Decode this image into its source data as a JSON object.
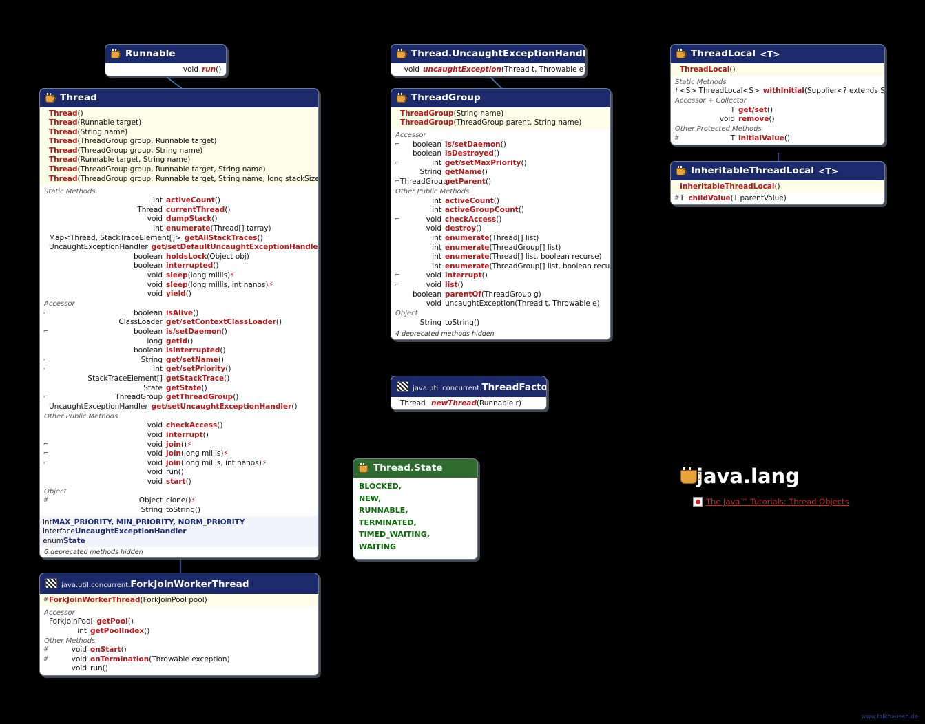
{
  "package": {
    "title": "java.lang",
    "tutorial_label": "The Java™ Tutorials: Thread Objects"
  },
  "credit": "www.falkhausen.de",
  "boxes": {
    "runnable": {
      "title": "Runnable",
      "rows": [
        {
          "mk": "",
          "rt": "void",
          "nm": "run",
          "italic": true,
          "args": " ()"
        }
      ]
    },
    "thread": {
      "title": "Thread",
      "ctors": [
        {
          "nm": "Thread",
          "args": " ()"
        },
        {
          "nm": "Thread",
          "args": " (Runnable target)"
        },
        {
          "nm": "Thread",
          "args": " (String name)"
        },
        {
          "nm": "Thread",
          "args": " (ThreadGroup group, Runnable target)"
        },
        {
          "nm": "Thread",
          "args": " (ThreadGroup group, String name)"
        },
        {
          "nm": "Thread",
          "args": " (Runnable target, String name)"
        },
        {
          "nm": "Thread",
          "args": " (ThreadGroup group, Runnable target, String name)"
        },
        {
          "nm": "Thread",
          "args": " (ThreadGroup group, Runnable target, String name, long stackSize)"
        }
      ],
      "groups": [
        {
          "label": "Static Methods",
          "rows": [
            {
              "mk": "",
              "rt": "int",
              "nm": "activeCount",
              "args": " ()"
            },
            {
              "mk": "",
              "rt": "Thread",
              "nm": "currentThread",
              "args": " ()"
            },
            {
              "mk": "",
              "rt": "void",
              "nm": "dumpStack",
              "args": " ()"
            },
            {
              "mk": "",
              "rt": "int",
              "nm": "enumerate",
              "args": " (Thread[] tarray)"
            },
            {
              "mk": "",
              "rt": "Map<Thread, StackTraceElement[]>",
              "nm": "getAllStackTraces",
              "args": " ()",
              "wide": true
            },
            {
              "mk": "",
              "rt": "UncaughtExceptionHandler",
              "nm": "get/setDefaultUncaughtExceptionHandler",
              "args": " ()",
              "wide": true
            },
            {
              "mk": "",
              "rt": "boolean",
              "nm": "holdsLock",
              "args": " (Object obj)"
            },
            {
              "mk": "",
              "rt": "boolean",
              "nm": "interrupted",
              "args": " ()"
            },
            {
              "mk": "",
              "rt": "void",
              "nm": "sleep",
              "args": " (long millis)",
              "pct": true
            },
            {
              "mk": "",
              "rt": "void",
              "nm": "sleep",
              "args": " (long millis, int nanos)",
              "pct": true
            },
            {
              "mk": "",
              "rt": "void",
              "nm": "yield",
              "args": " ()"
            }
          ]
        },
        {
          "label": "Accessor",
          "rows": [
            {
              "mk": "⌐",
              "rt": "boolean",
              "nm": "isAlive",
              "args": " ()"
            },
            {
              "mk": "",
              "rt": "ClassLoader",
              "nm": "get/setContextClassLoader",
              "args": " ()"
            },
            {
              "mk": "⌐",
              "rt": "boolean",
              "nm": "is/setDaemon",
              "args": " ()"
            },
            {
              "mk": "",
              "rt": "long",
              "nm": "getId",
              "args": " ()"
            },
            {
              "mk": "",
              "rt": "boolean",
              "nm": "isInterrupted",
              "args": " ()"
            },
            {
              "mk": "⌐",
              "rt": "String",
              "nm": "get/setName",
              "args": " ()"
            },
            {
              "mk": "⌐",
              "rt": "int",
              "nm": "get/setPriority",
              "args": " ()"
            },
            {
              "mk": "",
              "rt": "StackTraceElement[]",
              "nm": "getStackTrace",
              "args": " ()"
            },
            {
              "mk": "",
              "rt": "State",
              "nm": "getState",
              "args": " ()"
            },
            {
              "mk": "⌐",
              "rt": "ThreadGroup",
              "nm": "getThreadGroup",
              "args": " ()"
            },
            {
              "mk": "",
              "rt": "UncaughtExceptionHandler",
              "nm": "get/setUncaughtExceptionHandler",
              "args": " ()",
              "wide": true
            }
          ]
        },
        {
          "label": "Other Public Methods",
          "rows": [
            {
              "mk": "",
              "rt": "void",
              "nm": "checkAccess",
              "args": " ()"
            },
            {
              "mk": "",
              "rt": "void",
              "nm": "interrupt",
              "args": " ()"
            },
            {
              "mk": "⌐",
              "rt": "void",
              "nm": "join",
              "args": " ()",
              "pct": true
            },
            {
              "mk": "⌐",
              "rt": "void",
              "nm": "join",
              "args": " (long millis)",
              "pct": true
            },
            {
              "mk": "⌐",
              "rt": "void",
              "nm": "join",
              "args": " (long millis, int nanos)",
              "pct": true
            },
            {
              "mk": "",
              "rt": "void",
              "nm": "run",
              "args": " ()",
              "plain": true
            },
            {
              "mk": "",
              "rt": "void",
              "nm": "start",
              "args": " ()"
            }
          ]
        },
        {
          "label": "Object",
          "rows": [
            {
              "mk": "#",
              "rt": "Object",
              "nm": "clone",
              "args": " ()",
              "plain": true,
              "pct": true
            },
            {
              "mk": "",
              "rt": "String",
              "nm": "toString",
              "args": " ()",
              "plain": true
            }
          ]
        }
      ],
      "fields": [
        {
          "pre": "int",
          "nm": "MAX_PRIORITY, MIN_PRIORITY, NORM_PRIORITY"
        },
        {
          "pre": "interface",
          "nm": "UncaughtExceptionHandler"
        },
        {
          "pre": "enum",
          "nm": "State"
        }
      ],
      "deprecated": "6 deprecated methods hidden"
    },
    "forkjoin": {
      "pkg": "java.util.concurrent.",
      "title": "ForkJoinWorkerThread",
      "ctors": [
        {
          "mk": "#",
          "nm": "ForkJoinWorkerThread",
          "args": " (ForkJoinPool pool)"
        }
      ],
      "groups": [
        {
          "label": "Accessor",
          "rows": [
            {
              "mk": "",
              "rt": "ForkJoinPool",
              "nm": "getPool",
              "args": " ()",
              "leftType": true
            },
            {
              "mk": "",
              "rt": "int",
              "nm": "getPoolIndex",
              "args": " ()"
            }
          ]
        },
        {
          "label": "Other Methods",
          "rows": [
            {
              "mk": "#",
              "rt": "void",
              "nm": "onStart",
              "args": " ()"
            },
            {
              "mk": "#",
              "rt": "void",
              "nm": "onTermination",
              "args": " (Throwable exception)"
            },
            {
              "mk": "",
              "rt": "void",
              "nm": "run",
              "args": " ()",
              "plain": true
            }
          ]
        }
      ]
    },
    "ueh": {
      "title": "Thread.UncaughtExceptionHandler",
      "rows": [
        {
          "mk": "",
          "rt": "void",
          "nm": "uncaughtException",
          "italic": true,
          "args": " (Thread t, Throwable e)"
        }
      ]
    },
    "threadgroup": {
      "title": "ThreadGroup",
      "ctors": [
        {
          "nm": "ThreadGroup",
          "args": " (String name)"
        },
        {
          "nm": "ThreadGroup",
          "args": " (ThreadGroup parent, String name)"
        }
      ],
      "groups": [
        {
          "label": "Accessor",
          "rows": [
            {
              "mk": "⌐",
              "rt": "boolean",
              "nm": "is/setDaemon",
              "args": " ()"
            },
            {
              "mk": "",
              "rt": "boolean",
              "nm": "isDestroyed",
              "args": " ()"
            },
            {
              "mk": "⌐",
              "rt": "int",
              "nm": "get/setMaxPriority",
              "args": " ()"
            },
            {
              "mk": "",
              "rt": "String",
              "nm": "getName",
              "args": " ()"
            },
            {
              "mk": "⌐",
              "rt": "ThreadGroup",
              "nm": "getParent",
              "args": " ()"
            }
          ]
        },
        {
          "label": "Other Public Methods",
          "rows": [
            {
              "mk": "",
              "rt": "int",
              "nm": "activeCount",
              "args": " ()"
            },
            {
              "mk": "",
              "rt": "int",
              "nm": "activeGroupCount",
              "args": " ()"
            },
            {
              "mk": "⌐",
              "rt": "void",
              "nm": "checkAccess",
              "args": " ()"
            },
            {
              "mk": "",
              "rt": "void",
              "nm": "destroy",
              "args": " ()"
            },
            {
              "mk": "",
              "rt": "int",
              "nm": "enumerate",
              "args": " (Thread[] list)"
            },
            {
              "mk": "",
              "rt": "int",
              "nm": "enumerate",
              "args": " (ThreadGroup[] list)"
            },
            {
              "mk": "",
              "rt": "int",
              "nm": "enumerate",
              "args": " (Thread[] list, boolean recurse)"
            },
            {
              "mk": "",
              "rt": "int",
              "nm": "enumerate",
              "args": " (ThreadGroup[] list, boolean recurse)"
            },
            {
              "mk": "⌐",
              "rt": "void",
              "nm": "interrupt",
              "args": " ()"
            },
            {
              "mk": "⌐",
              "rt": "void",
              "nm": "list",
              "args": " ()"
            },
            {
              "mk": "",
              "rt": "boolean",
              "nm": "parentOf",
              "args": " (ThreadGroup g)"
            },
            {
              "mk": "",
              "rt": "void",
              "nm": "uncaughtException",
              "args": " (Thread t, Throwable e)",
              "plain": true
            }
          ]
        },
        {
          "label": "Object",
          "rows": [
            {
              "mk": "",
              "rt": "String",
              "nm": "toString",
              "args": " ()",
              "plain": true
            }
          ]
        }
      ],
      "deprecated": "4 deprecated methods hidden"
    },
    "threadfactory": {
      "pkg": "java.util.concurrent.",
      "title": "ThreadFactory",
      "rows": [
        {
          "mk": "",
          "rt": "Thread",
          "nm": "newThread",
          "italic": true,
          "args": " (Runnable r)",
          "leftType": true
        }
      ]
    },
    "threadlocal": {
      "title": "ThreadLocal",
      "generic": "<T>",
      "ctors": [
        {
          "nm": "ThreadLocal",
          "args": " ()"
        }
      ],
      "groups": [
        {
          "label": "Static Methods",
          "rows": [
            {
              "mk": "!",
              "rt": "<S> ThreadLocal<S>",
              "nm": "withInitial",
              "args": " (Supplier<? extends S> supplier)",
              "wide": true,
              "leftType": true
            }
          ]
        },
        {
          "label": "Accessor + Collector",
          "rows": [
            {
              "mk": "",
              "rt": "T",
              "nm": "get/set",
              "args": " ()"
            },
            {
              "mk": "",
              "rt": "void",
              "nm": "remove",
              "args": " ()"
            }
          ]
        },
        {
          "label": "Other Protected Methods",
          "rows": [
            {
              "mk": "#",
              "rt": "T",
              "nm": "initialValue",
              "args": " ()"
            }
          ]
        }
      ]
    },
    "inheritable": {
      "title": "InheritableThreadLocal",
      "generic": "<T>",
      "ctors": [
        {
          "nm": "InheritableThreadLocal",
          "args": " ()"
        }
      ],
      "groups": [
        {
          "label": "",
          "rows": [
            {
              "mk": "#",
              "rt": "T",
              "nm": "childValue",
              "args": " (T parentValue)",
              "leftType": true
            }
          ]
        }
      ]
    },
    "threadstate": {
      "title": "Thread.State",
      "values": [
        "BLOCKED,",
        "NEW,",
        "RUNNABLE,",
        "TERMINATED,",
        "TIMED_WAITING,",
        "WAITING"
      ]
    }
  }
}
